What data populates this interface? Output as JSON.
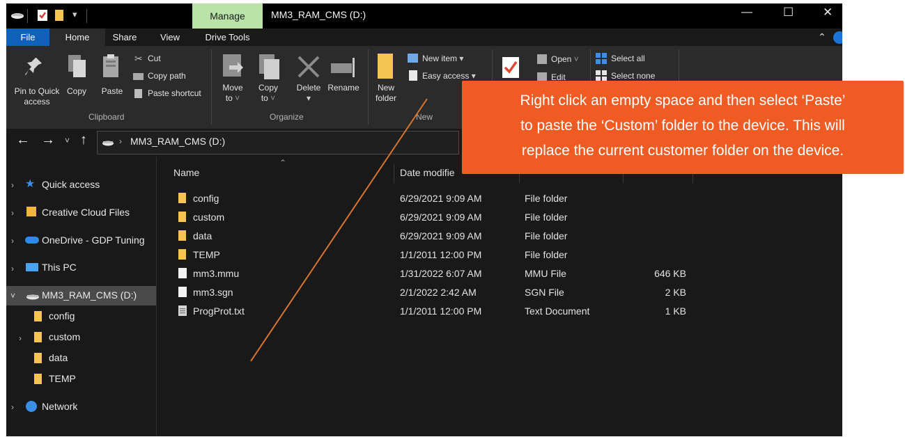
{
  "window": {
    "title": "MM3_RAM_CMS (D:)",
    "manage_tab": "Manage",
    "minimize": "—",
    "maximize": "☐",
    "close": "✕"
  },
  "tabs": [
    "File",
    "Home",
    "Share",
    "View",
    "Drive Tools"
  ],
  "ribbon": {
    "clipboard": {
      "pin": [
        "Pin to Quick",
        "access"
      ],
      "copy": "Copy",
      "paste": "Paste",
      "cut": "Cut",
      "copy_path": "Copy path",
      "paste_shortcut": "Paste shortcut",
      "group": "Clipboard"
    },
    "organize": {
      "move": [
        "Move",
        "to"
      ],
      "copy": [
        "Copy",
        "to"
      ],
      "delete": "Delete",
      "rename": "Rename",
      "group": "Organize"
    },
    "new": {
      "new_folder": [
        "New",
        "folder"
      ],
      "new_item": "New item",
      "easy_access": "Easy access",
      "group": "New"
    },
    "open": {
      "open": "Open",
      "edit": "Edit"
    },
    "select": {
      "select_all": "Select all",
      "select_none": "Select none"
    }
  },
  "address": {
    "path": "MM3_RAM_CMS (D:)"
  },
  "nav": {
    "quick_access": "Quick access",
    "creative_cloud": "Creative Cloud Files",
    "onedrive": "OneDrive - GDP Tuning",
    "this_pc": "This PC",
    "drive": "MM3_RAM_CMS (D:)",
    "children": [
      "config",
      "custom",
      "data",
      "TEMP"
    ],
    "network": "Network"
  },
  "columns": {
    "name": "Name",
    "date": "Date modifie"
  },
  "files": [
    {
      "name": "config",
      "date": "6/29/2021 9:09 AM",
      "type": "File folder",
      "size": "",
      "kind": "folder"
    },
    {
      "name": "custom",
      "date": "6/29/2021 9:09 AM",
      "type": "File folder",
      "size": "",
      "kind": "folder"
    },
    {
      "name": "data",
      "date": "6/29/2021 9:09 AM",
      "type": "File folder",
      "size": "",
      "kind": "folder"
    },
    {
      "name": "TEMP",
      "date": "1/1/2011 12:00 PM",
      "type": "File folder",
      "size": "",
      "kind": "folder"
    },
    {
      "name": "mm3.mmu",
      "date": "1/31/2022 6:07 AM",
      "type": "MMU File",
      "size": "646 KB",
      "kind": "file"
    },
    {
      "name": "mm3.sgn",
      "date": "2/1/2022 2:42 AM",
      "type": "SGN File",
      "size": "2 KB",
      "kind": "file"
    },
    {
      "name": "ProgProt.txt",
      "date": "1/1/2011 12:00 PM",
      "type": "Text Document",
      "size": "1 KB",
      "kind": "text"
    }
  ],
  "callout": {
    "lines": [
      "Right click an empty space and then select ‘Paste’",
      "to paste the ‘Custom’ folder to the device. This will",
      "replace the current customer folder on the device."
    ]
  },
  "colors": {
    "accent": "#1160b9",
    "callout": "#ef5b22",
    "folder": "#f6c452",
    "manage": "#b9e3a9"
  }
}
